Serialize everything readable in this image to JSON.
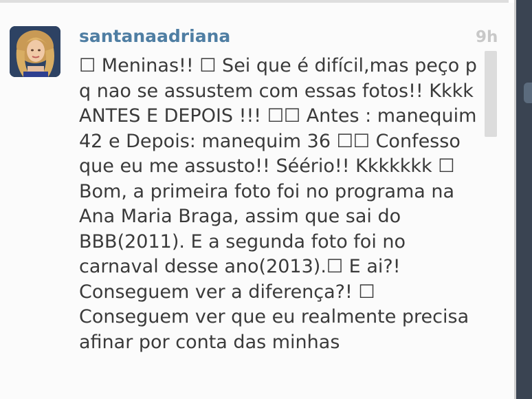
{
  "post": {
    "username": "santanaadriana",
    "timestamp": "9h",
    "caption": "☐ Meninas!! ☐ Sei que é difícil,mas peço p q nao se assustem com essas fotos!! Kkkk ANTES E DEPOIS !!! ☐☐ Antes : manequim 42 e Depois: manequim 36 ☐☐ Confesso que eu me assusto!! Séério!! Kkkkkkk ☐ Bom, a primeira foto foi no programa na Ana Maria Braga, assim que sai do BBB(2011). E a segunda foto foi no carnaval desse ano(2013).☐ E ai?! Conseguem ver a diferença?! ☐ Conseguem ver que eu realmente precisa afinar por conta das minhas"
  },
  "colors": {
    "username": "#4f7ea3",
    "timestamp": "#c8c8c8",
    "caption_text": "#3a3a3a",
    "panel_background": "#fbfbfb",
    "outer_background": "#3a4452"
  },
  "icons": {
    "avatar": "profile-photo",
    "placeholder_glyph": "missing-emoji-box"
  }
}
